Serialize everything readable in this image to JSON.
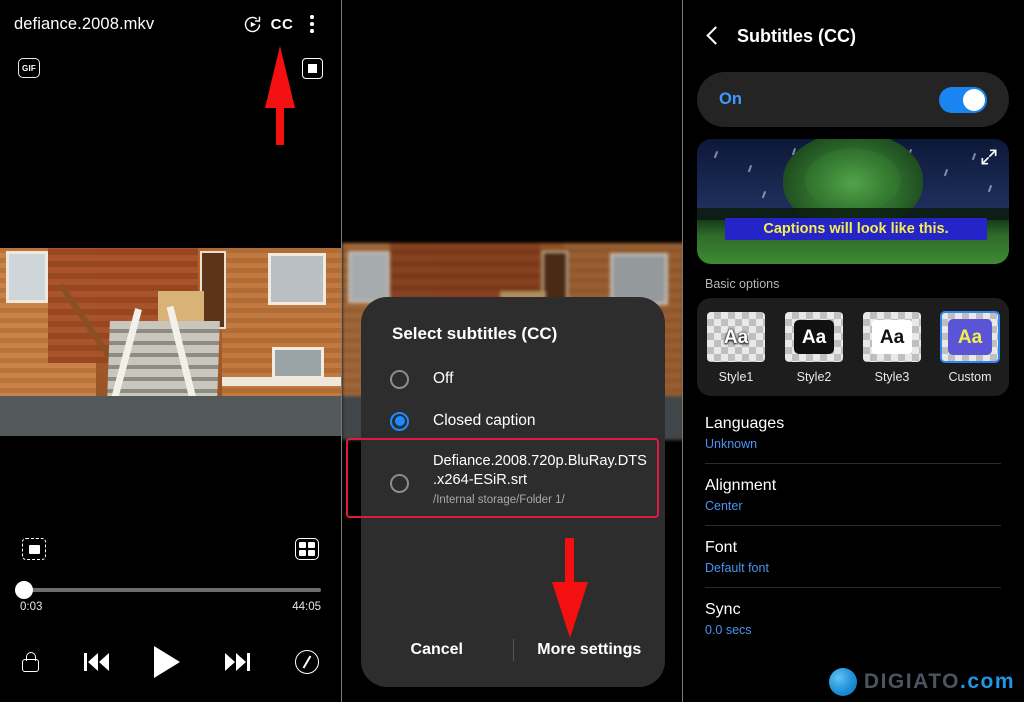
{
  "player": {
    "title": "defiance.2008.mkv",
    "icons": {
      "rotate": "rotate-play-icon",
      "cc_label": "CC",
      "overflow": "overflow-menu-icon",
      "gif_label": "GIF",
      "pip": "pip-icon",
      "capture": "capture-icon",
      "popup_view": "popup-view-icon",
      "lock": "lock-icon",
      "previous": "previous-icon",
      "play": "play-icon",
      "next": "next-icon",
      "rotate_screen": "rotate-screen-icon"
    },
    "time_current": "0:03",
    "time_total": "44:05",
    "progress_percent": 1
  },
  "dialog": {
    "title": "Select subtitles (CC)",
    "options": [
      {
        "label": "Off",
        "selected": false
      },
      {
        "label": "Closed caption",
        "selected": true
      }
    ],
    "file_option": {
      "name": "Defiance.2008.720p.BluRay.DTS.x264-ESiR.srt",
      "name_line1": "Defiance.2008.720p.BluRay.DTS",
      "name_line2": ".x264-ESiR.srt",
      "path": "/Internal storage/Folder 1/",
      "selected": false,
      "highlighted": true
    },
    "cancel_label": "Cancel",
    "more_settings_label": "More settings"
  },
  "settings_panel": {
    "title": "Subtitles (CC)",
    "back_icon": "back-chevron-icon",
    "toggle": {
      "label": "On",
      "on": true
    },
    "preview": {
      "caption_text": "Captions will look like this.",
      "caption_text_color": "#f5ef4e",
      "caption_bg_color": "#2424c8",
      "expand_icon": "expand-icon"
    },
    "basic_options_label": "Basic options",
    "styles": [
      {
        "name": "Style1",
        "selected": false
      },
      {
        "name": "Style2",
        "selected": false
      },
      {
        "name": "Style3",
        "selected": false
      },
      {
        "name": "Custom",
        "selected": true
      }
    ],
    "style_sample_text": "Aa",
    "rows": [
      {
        "title": "Languages",
        "value": "Unknown"
      },
      {
        "title": "Alignment",
        "value": "Center"
      },
      {
        "title": "Font",
        "value": "Default font"
      },
      {
        "title": "Sync",
        "value": "0.0 secs"
      }
    ]
  },
  "watermark": {
    "name": "DIGIATO",
    "suffix": ".com"
  },
  "annotations": {
    "arrow_top": "red-arrow-up",
    "arrow_bottom": "red-arrow-down",
    "highlight_color": "#e2193f"
  }
}
